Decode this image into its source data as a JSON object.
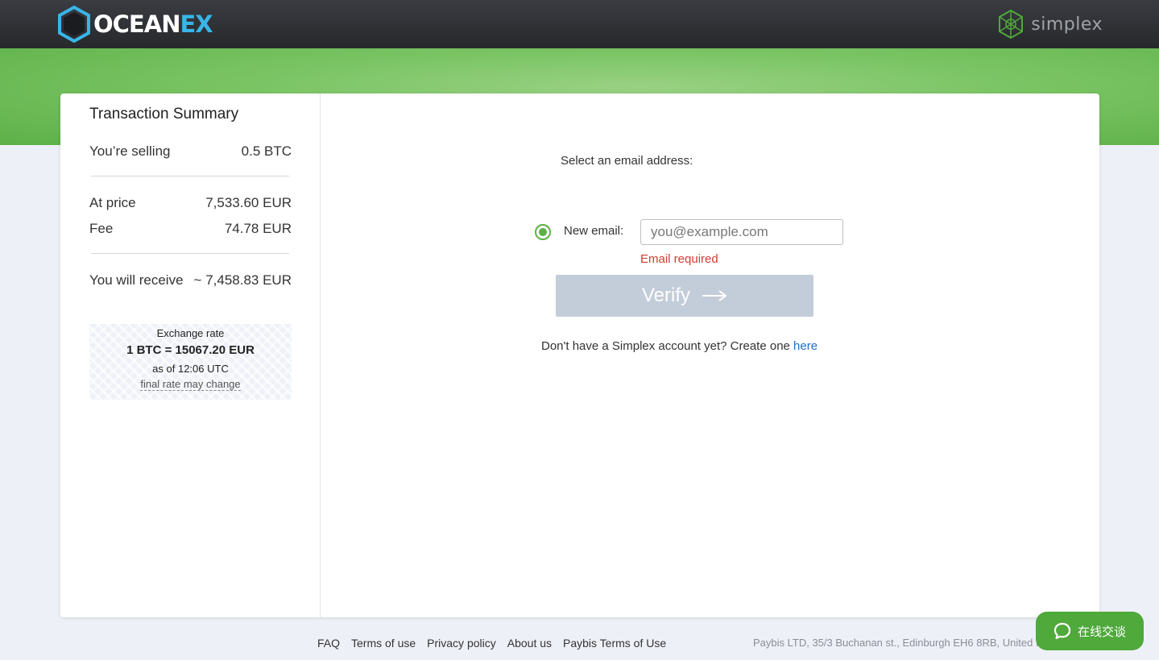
{
  "header": {
    "brand_left_main": "OCEAN",
    "brand_left_accent": "EX",
    "brand_right": "simplex"
  },
  "summary": {
    "title": "Transaction Summary",
    "selling_label": "You’re selling",
    "selling_value": "0.5 BTC",
    "price_label": "At price",
    "price_value": "7,533.60 EUR",
    "fee_label": "Fee",
    "fee_value": "74.78 EUR",
    "receive_label": "You will receive",
    "receive_value": "~ 7,458.83 EUR",
    "rate": {
      "title": "Exchange rate",
      "value": "1 BTC = 15067.20 EUR",
      "as_of": "as of 12:06 UTC",
      "note": "final rate may change"
    }
  },
  "form": {
    "select_label": "Select an email address:",
    "new_email_label": "New email:",
    "email_placeholder": "you@example.com",
    "email_value": "",
    "error": "Email required",
    "verify_label": "Verify",
    "signup_text": "Don't have a Simplex account yet? Create one ",
    "signup_link": "here"
  },
  "footer": {
    "links": [
      "FAQ",
      "Terms of use",
      "Privacy policy",
      "About us",
      "Paybis Terms of Use"
    ],
    "address": "Paybis LTD, 35/3 Buchanan st., Edinburgh EH6 8RB, United K"
  },
  "chat": {
    "label": "在线交谈"
  },
  "colors": {
    "accent_green": "#5db048",
    "error_red": "#d43b2f",
    "link_blue": "#1f6fc5",
    "verify_disabled": "#c3ccd9"
  }
}
